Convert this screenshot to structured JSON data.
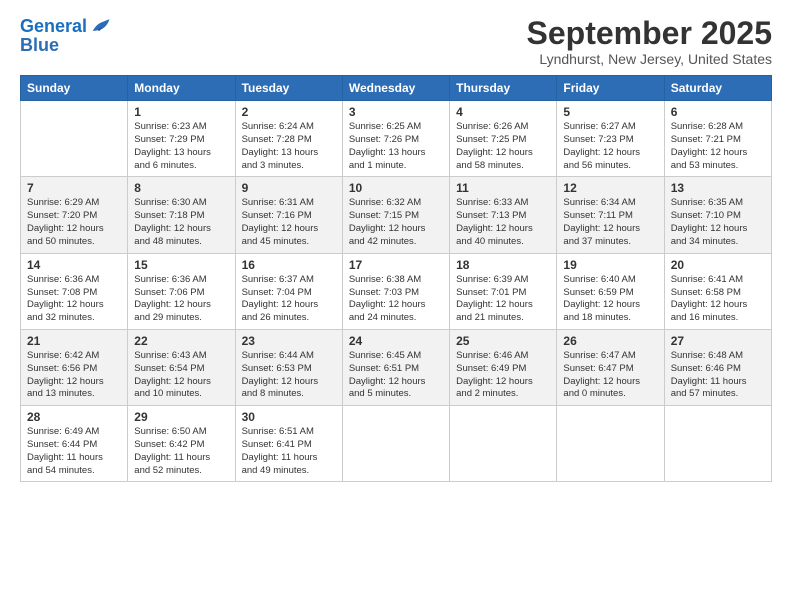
{
  "header": {
    "logo_line1": "General",
    "logo_line2": "Blue",
    "month": "September 2025",
    "location": "Lyndhurst, New Jersey, United States"
  },
  "days_of_week": [
    "Sunday",
    "Monday",
    "Tuesday",
    "Wednesday",
    "Thursday",
    "Friday",
    "Saturday"
  ],
  "weeks": [
    [
      {
        "day": "",
        "info": ""
      },
      {
        "day": "1",
        "info": "Sunrise: 6:23 AM\nSunset: 7:29 PM\nDaylight: 13 hours\nand 6 minutes."
      },
      {
        "day": "2",
        "info": "Sunrise: 6:24 AM\nSunset: 7:28 PM\nDaylight: 13 hours\nand 3 minutes."
      },
      {
        "day": "3",
        "info": "Sunrise: 6:25 AM\nSunset: 7:26 PM\nDaylight: 13 hours\nand 1 minute."
      },
      {
        "day": "4",
        "info": "Sunrise: 6:26 AM\nSunset: 7:25 PM\nDaylight: 12 hours\nand 58 minutes."
      },
      {
        "day": "5",
        "info": "Sunrise: 6:27 AM\nSunset: 7:23 PM\nDaylight: 12 hours\nand 56 minutes."
      },
      {
        "day": "6",
        "info": "Sunrise: 6:28 AM\nSunset: 7:21 PM\nDaylight: 12 hours\nand 53 minutes."
      }
    ],
    [
      {
        "day": "7",
        "info": "Sunrise: 6:29 AM\nSunset: 7:20 PM\nDaylight: 12 hours\nand 50 minutes."
      },
      {
        "day": "8",
        "info": "Sunrise: 6:30 AM\nSunset: 7:18 PM\nDaylight: 12 hours\nand 48 minutes."
      },
      {
        "day": "9",
        "info": "Sunrise: 6:31 AM\nSunset: 7:16 PM\nDaylight: 12 hours\nand 45 minutes."
      },
      {
        "day": "10",
        "info": "Sunrise: 6:32 AM\nSunset: 7:15 PM\nDaylight: 12 hours\nand 42 minutes."
      },
      {
        "day": "11",
        "info": "Sunrise: 6:33 AM\nSunset: 7:13 PM\nDaylight: 12 hours\nand 40 minutes."
      },
      {
        "day": "12",
        "info": "Sunrise: 6:34 AM\nSunset: 7:11 PM\nDaylight: 12 hours\nand 37 minutes."
      },
      {
        "day": "13",
        "info": "Sunrise: 6:35 AM\nSunset: 7:10 PM\nDaylight: 12 hours\nand 34 minutes."
      }
    ],
    [
      {
        "day": "14",
        "info": "Sunrise: 6:36 AM\nSunset: 7:08 PM\nDaylight: 12 hours\nand 32 minutes."
      },
      {
        "day": "15",
        "info": "Sunrise: 6:36 AM\nSunset: 7:06 PM\nDaylight: 12 hours\nand 29 minutes."
      },
      {
        "day": "16",
        "info": "Sunrise: 6:37 AM\nSunset: 7:04 PM\nDaylight: 12 hours\nand 26 minutes."
      },
      {
        "day": "17",
        "info": "Sunrise: 6:38 AM\nSunset: 7:03 PM\nDaylight: 12 hours\nand 24 minutes."
      },
      {
        "day": "18",
        "info": "Sunrise: 6:39 AM\nSunset: 7:01 PM\nDaylight: 12 hours\nand 21 minutes."
      },
      {
        "day": "19",
        "info": "Sunrise: 6:40 AM\nSunset: 6:59 PM\nDaylight: 12 hours\nand 18 minutes."
      },
      {
        "day": "20",
        "info": "Sunrise: 6:41 AM\nSunset: 6:58 PM\nDaylight: 12 hours\nand 16 minutes."
      }
    ],
    [
      {
        "day": "21",
        "info": "Sunrise: 6:42 AM\nSunset: 6:56 PM\nDaylight: 12 hours\nand 13 minutes."
      },
      {
        "day": "22",
        "info": "Sunrise: 6:43 AM\nSunset: 6:54 PM\nDaylight: 12 hours\nand 10 minutes."
      },
      {
        "day": "23",
        "info": "Sunrise: 6:44 AM\nSunset: 6:53 PM\nDaylight: 12 hours\nand 8 minutes."
      },
      {
        "day": "24",
        "info": "Sunrise: 6:45 AM\nSunset: 6:51 PM\nDaylight: 12 hours\nand 5 minutes."
      },
      {
        "day": "25",
        "info": "Sunrise: 6:46 AM\nSunset: 6:49 PM\nDaylight: 12 hours\nand 2 minutes."
      },
      {
        "day": "26",
        "info": "Sunrise: 6:47 AM\nSunset: 6:47 PM\nDaylight: 12 hours\nand 0 minutes."
      },
      {
        "day": "27",
        "info": "Sunrise: 6:48 AM\nSunset: 6:46 PM\nDaylight: 11 hours\nand 57 minutes."
      }
    ],
    [
      {
        "day": "28",
        "info": "Sunrise: 6:49 AM\nSunset: 6:44 PM\nDaylight: 11 hours\nand 54 minutes."
      },
      {
        "day": "29",
        "info": "Sunrise: 6:50 AM\nSunset: 6:42 PM\nDaylight: 11 hours\nand 52 minutes."
      },
      {
        "day": "30",
        "info": "Sunrise: 6:51 AM\nSunset: 6:41 PM\nDaylight: 11 hours\nand 49 minutes."
      },
      {
        "day": "",
        "info": ""
      },
      {
        "day": "",
        "info": ""
      },
      {
        "day": "",
        "info": ""
      },
      {
        "day": "",
        "info": ""
      }
    ]
  ]
}
